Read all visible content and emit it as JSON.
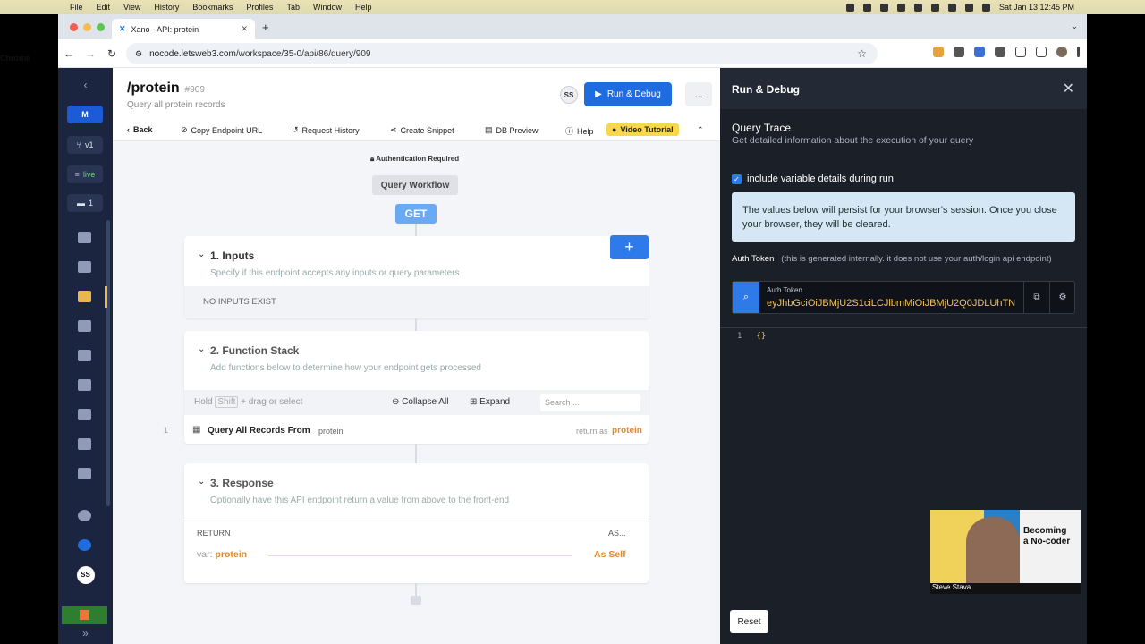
{
  "menubar": {
    "items": [
      "Chrome",
      "File",
      "Edit",
      "View",
      "History",
      "Bookmarks",
      "Profiles",
      "Tab",
      "Window",
      "Help"
    ],
    "datetime": "Sat Jan 13  12:45 PM"
  },
  "browser": {
    "tab_title": "Xano - API: protein",
    "url_host": "nocode.letsweb3.com",
    "url_path": "/workspace/35-0/api/86/query/909"
  },
  "leftnav": {
    "workspace_badge": "M",
    "version_badge": "v1",
    "live_badge": "live",
    "comments_badge": "1",
    "avatar": "SS"
  },
  "header": {
    "title": "/protein",
    "id": "#909",
    "subtitle": "Query all protein records",
    "avatar": "SS",
    "run_button": "Run & Debug",
    "more_button": "..."
  },
  "subnav": {
    "back": "Back",
    "copy_url": "Copy Endpoint URL",
    "history": "Request History",
    "snippet": "Create Snippet",
    "db_preview": "DB Preview",
    "help": "Help",
    "video": "Video Tutorial"
  },
  "workflow": {
    "auth_required": "Authentication Required",
    "query_workflow": "Query Workflow",
    "method": "GET"
  },
  "inputs": {
    "title": "1. Inputs",
    "desc": "Specify if this endpoint accepts any inputs or query parameters",
    "empty": "NO INPUTS EXIST"
  },
  "stack": {
    "title": "2. Function Stack",
    "desc": "Add functions below to determine how your endpoint gets processed",
    "hold": "Hold",
    "shift": "Shift",
    "hint": "+ drag or select",
    "collapse": "Collapse All",
    "expand": "Expand",
    "search_placeholder": "Search ...",
    "row_num": "1",
    "row_title": "Query All Records From",
    "row_table": "protein",
    "row_return": "return as",
    "row_var": "protein"
  },
  "response": {
    "title": "3. Response",
    "desc": "Optionally have this API endpoint return a value from above to the front-end",
    "col_return": "RETURN",
    "col_as": "AS...",
    "var_prefix": "var:",
    "var_name": "protein",
    "as_value": "As Self"
  },
  "panel": {
    "title": "Run & Debug",
    "trace_title": "Query Trace",
    "trace_sub": "Get detailed information about the execution of your query",
    "checkbox_label": "include variable details during run",
    "checkbox_checked": true,
    "info": "The values below will persist for your browser's session. Once you close your browser, they will be cleared.",
    "auth_label": "Auth Token",
    "auth_note": "(this is generated internally. it does not use your auth/login api endpoint)",
    "token_label": "Auth Token",
    "token_value": "eyJhbGciOiJBMjU2S1ciLCJlbmMiOiJBMjU2Q0JDLUhTN",
    "code_line_num": "1",
    "code_line_val": "{}",
    "reset": "Reset"
  },
  "webcam": {
    "brand_line1": "Becoming",
    "brand_line2": "a No-coder",
    "name": "Steve Stava"
  },
  "colors": {
    "accent": "#1e6ce0",
    "nav_bg": "#1b2540",
    "panel_bg": "#1b1f27",
    "orange": "#e08a2c"
  }
}
